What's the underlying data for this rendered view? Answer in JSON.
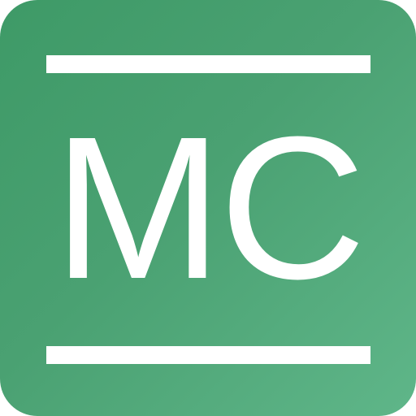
{
  "app_icon": {
    "monogram": "MC",
    "colors": {
      "background_start": "#3e9a67",
      "background_end": "#5fb689",
      "foreground": "#ffffff"
    }
  }
}
